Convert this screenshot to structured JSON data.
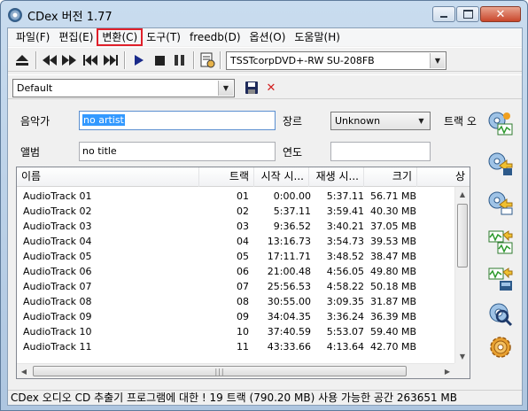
{
  "window": {
    "title": "CDex 버전 1.77"
  },
  "menu": [
    "파일(F)",
    "편집(E)",
    "변환(C)",
    "도구(T)",
    "freedb(D)",
    "옵션(O)",
    "도움말(H)"
  ],
  "toolbar": {
    "drive": "TSSTcorpDVD+-RW SU-208FB",
    "profile": "Default"
  },
  "fields": {
    "artist_label": "음악가",
    "artist_value": "no artist",
    "album_label": "앨범",
    "album_value": "no title",
    "genre_label": "장르",
    "genre_value": "Unknown",
    "year_label": "연도",
    "year_value": "",
    "track_offset_label": "트랙 오"
  },
  "list": {
    "columns": [
      "이름",
      "트랙",
      "시작 시...",
      "재생 시...",
      "크기",
      "상"
    ],
    "rows": [
      {
        "name": "AudioTrack 01",
        "track": "01",
        "start": "0:00.00",
        "play": "5:37.11",
        "size": "56.71 MB"
      },
      {
        "name": "AudioTrack 02",
        "track": "02",
        "start": "5:37.11",
        "play": "3:59.41",
        "size": "40.30 MB"
      },
      {
        "name": "AudioTrack 03",
        "track": "03",
        "start": "9:36.52",
        "play": "3:40.21",
        "size": "37.05 MB"
      },
      {
        "name": "AudioTrack 04",
        "track": "04",
        "start": "13:16.73",
        "play": "3:54.73",
        "size": "39.53 MB"
      },
      {
        "name": "AudioTrack 05",
        "track": "05",
        "start": "17:11.71",
        "play": "3:48.52",
        "size": "38.47 MB"
      },
      {
        "name": "AudioTrack 06",
        "track": "06",
        "start": "21:00.48",
        "play": "4:56.05",
        "size": "49.80 MB"
      },
      {
        "name": "AudioTrack 07",
        "track": "07",
        "start": "25:56.53",
        "play": "4:58.22",
        "size": "50.18 MB"
      },
      {
        "name": "AudioTrack 08",
        "track": "08",
        "start": "30:55.00",
        "play": "3:09.35",
        "size": "31.87 MB"
      },
      {
        "name": "AudioTrack 09",
        "track": "09",
        "start": "34:04.35",
        "play": "3:36.24",
        "size": "36.39 MB"
      },
      {
        "name": "AudioTrack 10",
        "track": "10",
        "start": "37:40.59",
        "play": "5:53.07",
        "size": "59.40 MB"
      },
      {
        "name": "AudioTrack 11",
        "track": "11",
        "start": "43:33.66",
        "play": "4:13.64",
        "size": "42.70 MB"
      }
    ]
  },
  "status": "CDex 오디오 CD 추출기 프로그램에 대한 ! 19 트랙 (790.20 MB) 사용 가능한 공간 263651 MB"
}
